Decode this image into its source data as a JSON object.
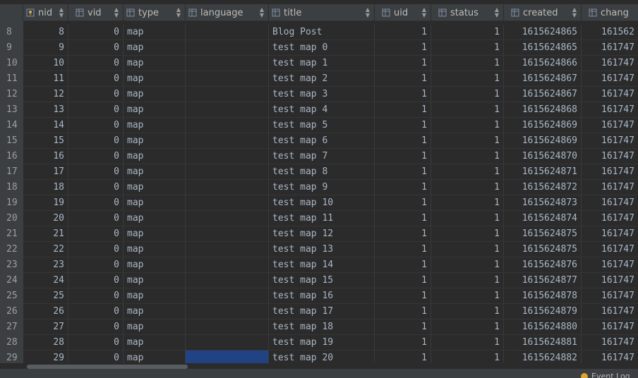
{
  "columns": [
    {
      "label": "nid",
      "icon": "key-column-icon"
    },
    {
      "label": "vid",
      "icon": "column-icon"
    },
    {
      "label": "type",
      "icon": "column-icon"
    },
    {
      "label": "language",
      "icon": "column-icon"
    },
    {
      "label": "title",
      "icon": "column-icon"
    },
    {
      "label": "uid",
      "icon": "column-icon"
    },
    {
      "label": "status",
      "icon": "column-icon"
    },
    {
      "label": "created",
      "icon": "column-icon"
    },
    {
      "label": "chang",
      "icon": "column-icon"
    }
  ],
  "rows": [
    {
      "rn": "8",
      "nid": "8",
      "vid": "0",
      "type": "map",
      "language": "",
      "title": "Blog Post",
      "uid": "1",
      "status": "1",
      "created": "1615624865",
      "changed": "161562"
    },
    {
      "rn": "9",
      "nid": "9",
      "vid": "0",
      "type": "map",
      "language": "",
      "title": "test map 0",
      "uid": "1",
      "status": "1",
      "created": "1615624865",
      "changed": "161747"
    },
    {
      "rn": "10",
      "nid": "10",
      "vid": "0",
      "type": "map",
      "language": "",
      "title": "test map 1",
      "uid": "1",
      "status": "1",
      "created": "1615624866",
      "changed": "161747"
    },
    {
      "rn": "11",
      "nid": "11",
      "vid": "0",
      "type": "map",
      "language": "",
      "title": "test map 2",
      "uid": "1",
      "status": "1",
      "created": "1615624867",
      "changed": "161747"
    },
    {
      "rn": "12",
      "nid": "12",
      "vid": "0",
      "type": "map",
      "language": "",
      "title": "test map 3",
      "uid": "1",
      "status": "1",
      "created": "1615624867",
      "changed": "161747"
    },
    {
      "rn": "13",
      "nid": "13",
      "vid": "0",
      "type": "map",
      "language": "",
      "title": "test map 4",
      "uid": "1",
      "status": "1",
      "created": "1615624868",
      "changed": "161747"
    },
    {
      "rn": "14",
      "nid": "14",
      "vid": "0",
      "type": "map",
      "language": "",
      "title": "test map 5",
      "uid": "1",
      "status": "1",
      "created": "1615624869",
      "changed": "161747"
    },
    {
      "rn": "15",
      "nid": "15",
      "vid": "0",
      "type": "map",
      "language": "",
      "title": "test map 6",
      "uid": "1",
      "status": "1",
      "created": "1615624869",
      "changed": "161747"
    },
    {
      "rn": "16",
      "nid": "16",
      "vid": "0",
      "type": "map",
      "language": "",
      "title": "test map 7",
      "uid": "1",
      "status": "1",
      "created": "1615624870",
      "changed": "161747"
    },
    {
      "rn": "17",
      "nid": "17",
      "vid": "0",
      "type": "map",
      "language": "",
      "title": "test map 8",
      "uid": "1",
      "status": "1",
      "created": "1615624871",
      "changed": "161747"
    },
    {
      "rn": "18",
      "nid": "18",
      "vid": "0",
      "type": "map",
      "language": "",
      "title": "test map 9",
      "uid": "1",
      "status": "1",
      "created": "1615624872",
      "changed": "161747"
    },
    {
      "rn": "19",
      "nid": "19",
      "vid": "0",
      "type": "map",
      "language": "",
      "title": "test map 10",
      "uid": "1",
      "status": "1",
      "created": "1615624873",
      "changed": "161747"
    },
    {
      "rn": "20",
      "nid": "20",
      "vid": "0",
      "type": "map",
      "language": "",
      "title": "test map 11",
      "uid": "1",
      "status": "1",
      "created": "1615624874",
      "changed": "161747"
    },
    {
      "rn": "21",
      "nid": "21",
      "vid": "0",
      "type": "map",
      "language": "",
      "title": "test map 12",
      "uid": "1",
      "status": "1",
      "created": "1615624875",
      "changed": "161747"
    },
    {
      "rn": "22",
      "nid": "22",
      "vid": "0",
      "type": "map",
      "language": "",
      "title": "test map 13",
      "uid": "1",
      "status": "1",
      "created": "1615624875",
      "changed": "161747"
    },
    {
      "rn": "23",
      "nid": "23",
      "vid": "0",
      "type": "map",
      "language": "",
      "title": "test map 14",
      "uid": "1",
      "status": "1",
      "created": "1615624876",
      "changed": "161747"
    },
    {
      "rn": "24",
      "nid": "24",
      "vid": "0",
      "type": "map",
      "language": "",
      "title": "test map 15",
      "uid": "1",
      "status": "1",
      "created": "1615624877",
      "changed": "161747"
    },
    {
      "rn": "25",
      "nid": "25",
      "vid": "0",
      "type": "map",
      "language": "",
      "title": "test map 16",
      "uid": "1",
      "status": "1",
      "created": "1615624878",
      "changed": "161747"
    },
    {
      "rn": "26",
      "nid": "26",
      "vid": "0",
      "type": "map",
      "language": "",
      "title": "test map 17",
      "uid": "1",
      "status": "1",
      "created": "1615624879",
      "changed": "161747"
    },
    {
      "rn": "27",
      "nid": "27",
      "vid": "0",
      "type": "map",
      "language": "",
      "title": "test map 18",
      "uid": "1",
      "status": "1",
      "created": "1615624880",
      "changed": "161747"
    },
    {
      "rn": "28",
      "nid": "28",
      "vid": "0",
      "type": "map",
      "language": "",
      "title": "test map 19",
      "uid": "1",
      "status": "1",
      "created": "1615624881",
      "changed": "161747"
    },
    {
      "rn": "29",
      "nid": "29",
      "vid": "0",
      "type": "map",
      "language": "",
      "title": "test map 20",
      "uid": "1",
      "status": "1",
      "created": "1615624882",
      "changed": "161747",
      "selected_cell": "language"
    }
  ],
  "status_bar": {
    "label": "Event Log"
  },
  "colors": {
    "background": "#2b2b2b",
    "header": "#3c3f41",
    "selection": "#214283",
    "text": "#a9b7c6"
  }
}
